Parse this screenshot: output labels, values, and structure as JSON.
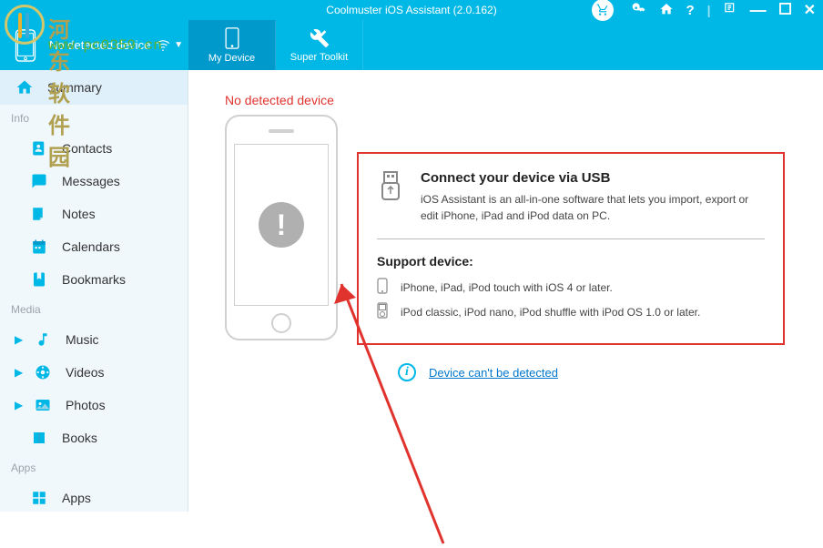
{
  "title": "Coolmuster iOS Assistant (2.0.162)",
  "watermark": {
    "cn": "河东软件园",
    "url": "www.pc0359.cn"
  },
  "topbar": {
    "device_label": "No detected device",
    "tabs": [
      {
        "label": "My Device"
      },
      {
        "label": "Super Toolkit"
      }
    ]
  },
  "sidebar": {
    "summary": "Summary",
    "sections": [
      {
        "title": "Info",
        "items": [
          "Contacts",
          "Messages",
          "Notes",
          "Calendars",
          "Bookmarks"
        ]
      },
      {
        "title": "Media",
        "items": [
          "Music",
          "Videos",
          "Photos",
          "Books"
        ]
      },
      {
        "title": "Apps",
        "items": [
          "Apps"
        ]
      }
    ]
  },
  "content": {
    "no_device": "No detected device",
    "connect_heading": "Connect your device via USB",
    "connect_desc": "iOS Assistant is an all-in-one software that lets you import, export or edit iPhone, iPad and iPod data on PC.",
    "support_heading": "Support device:",
    "support1": "iPhone, iPad, iPod touch with iOS 4 or later.",
    "support2": "iPod classic, iPod nano, iPod shuffle with iPod OS 1.0 or later.",
    "detect_link": "Device can't be detected"
  }
}
